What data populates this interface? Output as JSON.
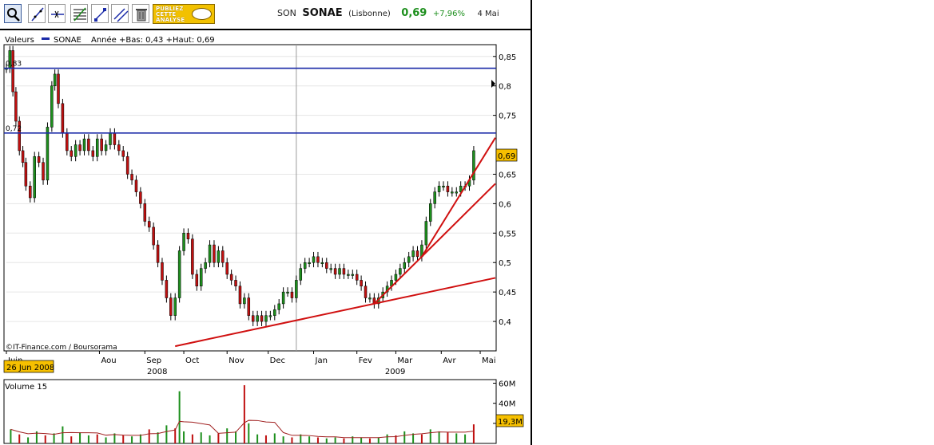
{
  "toolbar": {
    "tools": [
      "magnifier-icon",
      "draw-line-icon",
      "horizontal-line-icon",
      "fibonacci-icon",
      "trend-channel-icon",
      "parallel-lines-icon",
      "trash-icon"
    ],
    "promo": {
      "line1": "PUBLIEZ",
      "line2": "CETTE",
      "line3": "ANALYSE"
    }
  },
  "header": {
    "code": "SON",
    "name": "SONAE",
    "market": "(Lisbonne)",
    "price": "0,69",
    "change": "+7,96%",
    "date": "4 Mai",
    "price_color": "#1d8f1d"
  },
  "chart_data": [
    {
      "type": "line",
      "title": "",
      "legend_label": "Valeurs",
      "series_name": "SONAE",
      "legend_stats": "Année +Bas: 0,43 +Haut: 0,69",
      "last_value_label": "0,69",
      "date_label": "26 Jun 2008",
      "credit": "IT-Finance.com / Boursorama",
      "ylim": [
        0.35,
        0.87
      ],
      "y_ticks": [
        "0,4",
        "0,45",
        "0,5",
        "0,55",
        "0,6",
        "0,65",
        "0,75",
        "0,8",
        "0,85"
      ],
      "y_tick_values": [
        0.4,
        0.45,
        0.5,
        0.55,
        0.6,
        0.65,
        0.75,
        0.8,
        0.85
      ],
      "x_month_labels": [
        "Juin",
        "Aou",
        "Sep",
        "Oct",
        "Nov",
        "Dec",
        "Jan",
        "Fev",
        "Mar",
        "Avr",
        "Mai"
      ],
      "x_month_positions": [
        0,
        2.15,
        3.2,
        4.1,
        5.1,
        6.05,
        7.1,
        8.1,
        9.0,
        10.05,
        10.95
      ],
      "x_year_labels": [
        "2008",
        "2009"
      ],
      "x_year_positions": [
        3.25,
        8.75
      ],
      "x_range": [
        0,
        11.3
      ],
      "year_divider_x": 6.7,
      "price": [
        [
          0.0,
          0.83
        ],
        [
          0.08,
          0.86
        ],
        [
          0.15,
          0.79
        ],
        [
          0.22,
          0.74
        ],
        [
          0.3,
          0.69
        ],
        [
          0.38,
          0.67
        ],
        [
          0.45,
          0.63
        ],
        [
          0.55,
          0.61
        ],
        [
          0.65,
          0.68
        ],
        [
          0.75,
          0.67
        ],
        [
          0.85,
          0.64
        ],
        [
          0.95,
          0.73
        ],
        [
          1.05,
          0.8
        ],
        [
          1.12,
          0.82
        ],
        [
          1.2,
          0.77
        ],
        [
          1.3,
          0.72
        ],
        [
          1.4,
          0.69
        ],
        [
          1.5,
          0.68
        ],
        [
          1.6,
          0.7
        ],
        [
          1.7,
          0.69
        ],
        [
          1.8,
          0.71
        ],
        [
          1.9,
          0.69
        ],
        [
          2.0,
          0.68
        ],
        [
          2.1,
          0.71
        ],
        [
          2.2,
          0.69
        ],
        [
          2.3,
          0.7
        ],
        [
          2.4,
          0.72
        ],
        [
          2.5,
          0.7
        ],
        [
          2.6,
          0.69
        ],
        [
          2.7,
          0.68
        ],
        [
          2.8,
          0.65
        ],
        [
          2.9,
          0.64
        ],
        [
          3.0,
          0.62
        ],
        [
          3.1,
          0.6
        ],
        [
          3.2,
          0.57
        ],
        [
          3.3,
          0.56
        ],
        [
          3.4,
          0.53
        ],
        [
          3.5,
          0.5
        ],
        [
          3.6,
          0.47
        ],
        [
          3.7,
          0.44
        ],
        [
          3.8,
          0.41
        ],
        [
          3.9,
          0.44
        ],
        [
          4.0,
          0.52
        ],
        [
          4.1,
          0.55
        ],
        [
          4.2,
          0.54
        ],
        [
          4.3,
          0.48
        ],
        [
          4.4,
          0.46
        ],
        [
          4.5,
          0.49
        ],
        [
          4.6,
          0.5
        ],
        [
          4.7,
          0.53
        ],
        [
          4.8,
          0.5
        ],
        [
          4.9,
          0.52
        ],
        [
          5.0,
          0.5
        ],
        [
          5.1,
          0.48
        ],
        [
          5.2,
          0.47
        ],
        [
          5.3,
          0.46
        ],
        [
          5.4,
          0.43
        ],
        [
          5.5,
          0.44
        ],
        [
          5.6,
          0.41
        ],
        [
          5.7,
          0.4
        ],
        [
          5.8,
          0.41
        ],
        [
          5.9,
          0.4
        ],
        [
          6.0,
          0.41
        ],
        [
          6.1,
          0.41
        ],
        [
          6.2,
          0.42
        ],
        [
          6.3,
          0.43
        ],
        [
          6.4,
          0.45
        ],
        [
          6.5,
          0.45
        ],
        [
          6.6,
          0.44
        ],
        [
          6.7,
          0.47
        ],
        [
          6.8,
          0.49
        ],
        [
          6.9,
          0.5
        ],
        [
          7.0,
          0.5
        ],
        [
          7.1,
          0.51
        ],
        [
          7.2,
          0.5
        ],
        [
          7.3,
          0.5
        ],
        [
          7.4,
          0.49
        ],
        [
          7.5,
          0.49
        ],
        [
          7.6,
          0.48
        ],
        [
          7.7,
          0.49
        ],
        [
          7.8,
          0.48
        ],
        [
          7.9,
          0.48
        ],
        [
          8.0,
          0.48
        ],
        [
          8.1,
          0.47
        ],
        [
          8.2,
          0.46
        ],
        [
          8.3,
          0.44
        ],
        [
          8.4,
          0.44
        ],
        [
          8.5,
          0.43
        ],
        [
          8.6,
          0.44
        ],
        [
          8.7,
          0.45
        ],
        [
          8.8,
          0.46
        ],
        [
          8.9,
          0.47
        ],
        [
          9.0,
          0.48
        ],
        [
          9.1,
          0.49
        ],
        [
          9.2,
          0.5
        ],
        [
          9.3,
          0.51
        ],
        [
          9.4,
          0.52
        ],
        [
          9.5,
          0.51
        ],
        [
          9.6,
          0.53
        ],
        [
          9.7,
          0.57
        ],
        [
          9.8,
          0.6
        ],
        [
          9.9,
          0.62
        ],
        [
          10.0,
          0.63
        ],
        [
          10.1,
          0.63
        ],
        [
          10.2,
          0.62
        ],
        [
          10.3,
          0.62
        ],
        [
          10.4,
          0.62
        ],
        [
          10.5,
          0.63
        ],
        [
          10.6,
          0.63
        ],
        [
          10.7,
          0.64
        ],
        [
          10.8,
          0.69
        ]
      ],
      "annotations": {
        "resistance_lines": [
          {
            "value": 0.83,
            "label": "0,83",
            "color": "#1a2aa8"
          },
          {
            "value": 0.72,
            "label": "0,72",
            "color": "#1a2aa8"
          }
        ],
        "trend_lines": [
          {
            "from": [
              3.9,
              0.358
            ],
            "to": [
              11.3,
              0.474
            ],
            "color": "#d01010"
          },
          {
            "from": [
              8.5,
              0.43
            ],
            "to": [
              11.3,
              0.634
            ],
            "color": "#d01010"
          },
          {
            "from": [
              9.6,
              0.51
            ],
            "to": [
              11.3,
              0.712
            ],
            "color": "#d01010"
          }
        ]
      },
      "colors": {
        "up": "#1d8f1d",
        "down": "#c01010",
        "grid": "#e6e6e6"
      }
    },
    {
      "type": "bar",
      "title": "Volume 15",
      "y_ticks": [
        "60M",
        "40M",
        "20M"
      ],
      "y_tick_values": [
        60,
        40,
        20
      ],
      "ylim": [
        0,
        62
      ],
      "last_value_label": "19,3M",
      "moving_average_label": "15",
      "volume": [
        [
          0.1,
          14
        ],
        [
          0.3,
          9
        ],
        [
          0.5,
          6
        ],
        [
          0.7,
          12
        ],
        [
          0.9,
          8
        ],
        [
          1.1,
          10
        ],
        [
          1.3,
          17
        ],
        [
          1.5,
          7
        ],
        [
          1.7,
          11
        ],
        [
          1.9,
          8
        ],
        [
          2.1,
          9
        ],
        [
          2.3,
          6
        ],
        [
          2.5,
          10
        ],
        [
          2.7,
          8
        ],
        [
          2.9,
          7
        ],
        [
          3.1,
          9
        ],
        [
          3.3,
          14
        ],
        [
          3.5,
          11
        ],
        [
          3.7,
          18
        ],
        [
          3.9,
          15
        ],
        [
          4.0,
          52
        ],
        [
          4.1,
          12
        ],
        [
          4.3,
          9
        ],
        [
          4.5,
          11
        ],
        [
          4.7,
          8
        ],
        [
          4.9,
          10
        ],
        [
          5.1,
          15
        ],
        [
          5.3,
          12
        ],
        [
          5.5,
          58
        ],
        [
          5.6,
          20
        ],
        [
          5.8,
          9
        ],
        [
          6.0,
          8
        ],
        [
          6.2,
          10
        ],
        [
          6.4,
          7
        ],
        [
          6.6,
          6
        ],
        [
          6.8,
          9
        ],
        [
          7.0,
          7
        ],
        [
          7.2,
          6
        ],
        [
          7.4,
          5
        ],
        [
          7.6,
          6
        ],
        [
          7.8,
          5
        ],
        [
          8.0,
          7
        ],
        [
          8.2,
          6
        ],
        [
          8.4,
          5
        ],
        [
          8.6,
          6
        ],
        [
          8.8,
          9
        ],
        [
          9.0,
          8
        ],
        [
          9.2,
          12
        ],
        [
          9.4,
          10
        ],
        [
          9.6,
          9
        ],
        [
          9.8,
          14
        ],
        [
          10.0,
          12
        ],
        [
          10.2,
          11
        ],
        [
          10.4,
          10
        ],
        [
          10.6,
          9
        ],
        [
          10.8,
          19
        ]
      ],
      "colors": {
        "bar": "#1d8f1d",
        "bar_down": "#c01010",
        "ma": "#a02020"
      }
    }
  ]
}
